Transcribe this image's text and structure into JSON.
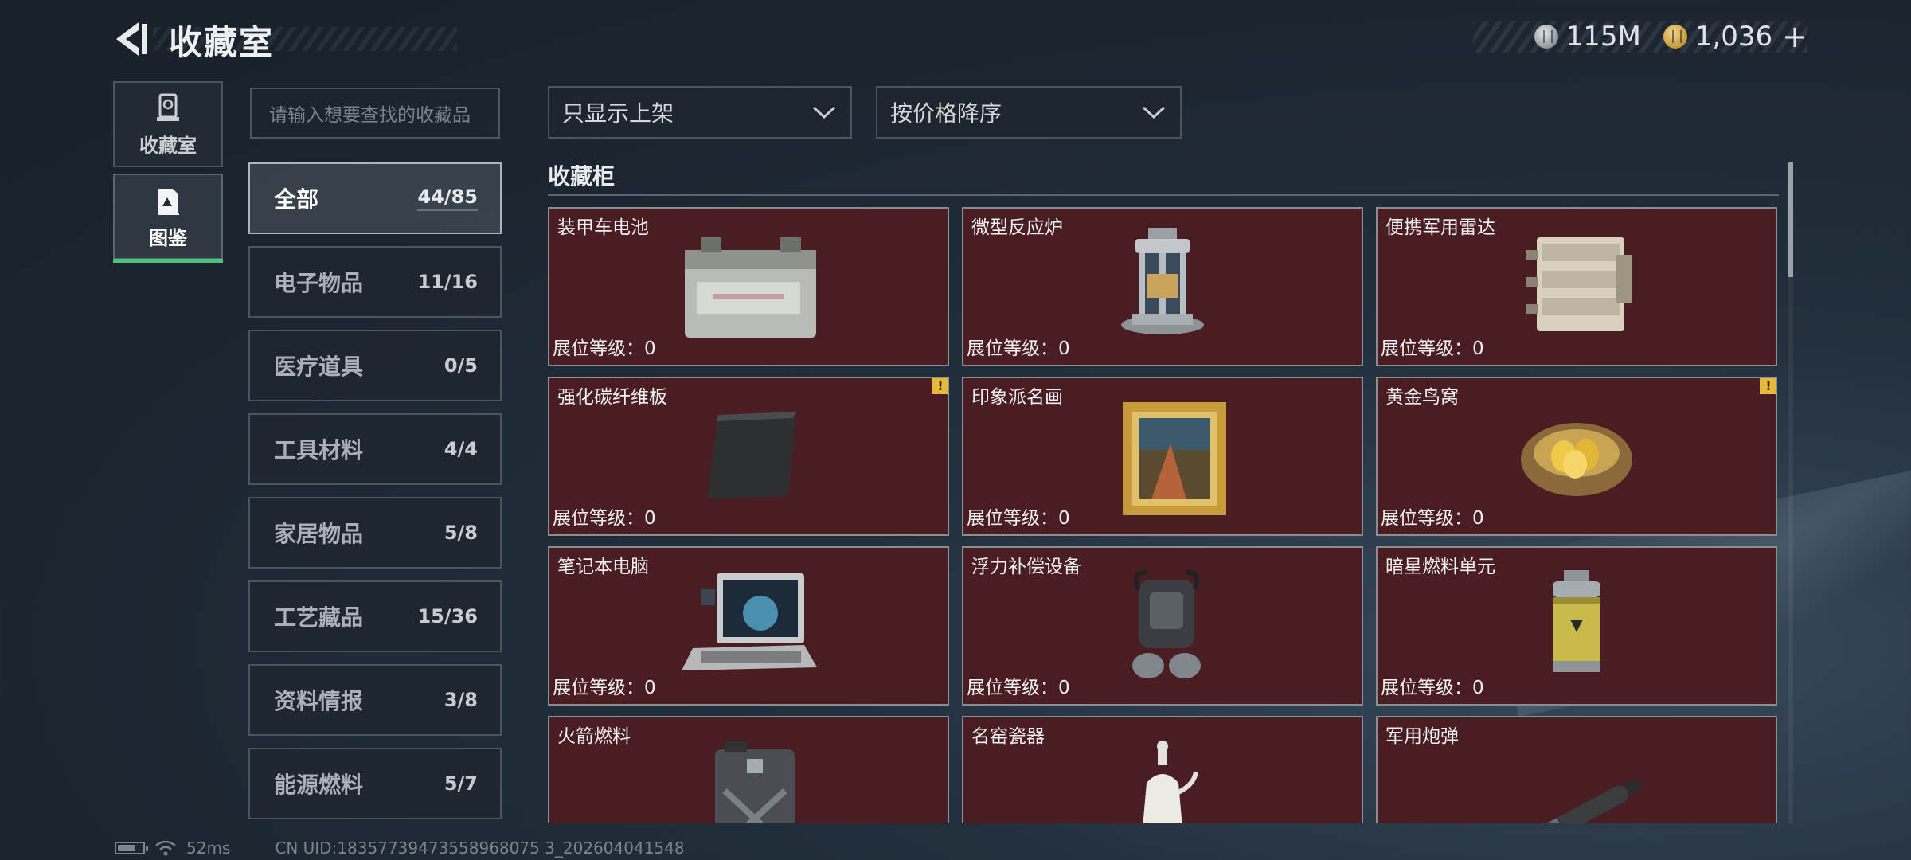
{
  "header": {
    "title": "收藏室",
    "currency": [
      {
        "icon": "silver-coin-icon",
        "value": "115M"
      },
      {
        "icon": "gold-coin-icon",
        "value": "1,036"
      }
    ],
    "add_label": "+"
  },
  "side_nav": [
    {
      "label": "收藏室",
      "icon": "collection-room-icon",
      "active": false
    },
    {
      "label": "图鉴",
      "icon": "codex-icon",
      "active": true
    }
  ],
  "search": {
    "placeholder": "请输入想要查找的收藏品"
  },
  "categories": [
    {
      "name": "全部",
      "count": "44/85",
      "active": true
    },
    {
      "name": "电子物品",
      "count": "11/16"
    },
    {
      "name": "医疗道具",
      "count": "0/5"
    },
    {
      "name": "工具材料",
      "count": "4/4"
    },
    {
      "name": "家居物品",
      "count": "5/8"
    },
    {
      "name": "工艺藏品",
      "count": "15/36"
    },
    {
      "name": "资料情报",
      "count": "3/8"
    },
    {
      "name": "能源燃料",
      "count": "5/7"
    }
  ],
  "filters": {
    "shelf": "只显示上架",
    "sort": "按价格降序"
  },
  "section": {
    "title": "收藏柜"
  },
  "level_label": "展位等级：",
  "items": [
    {
      "name": "装甲车电池",
      "level": "0",
      "icon": "battery-item-icon",
      "warn": false
    },
    {
      "name": "微型反应炉",
      "level": "0",
      "icon": "reactor-item-icon",
      "warn": false
    },
    {
      "name": "便携军用雷达",
      "level": "0",
      "icon": "radar-item-icon",
      "warn": false
    },
    {
      "name": "强化碳纤维板",
      "level": "0",
      "icon": "carbon-plate-item-icon",
      "warn": true
    },
    {
      "name": "印象派名画",
      "level": "0",
      "icon": "painting-item-icon",
      "warn": false
    },
    {
      "name": "黄金鸟窝",
      "level": "0",
      "icon": "golden-nest-item-icon",
      "warn": true
    },
    {
      "name": "笔记本电脑",
      "level": "0",
      "icon": "laptop-item-icon",
      "warn": false
    },
    {
      "name": "浮力补偿设备",
      "level": "0",
      "icon": "buoyancy-device-item-icon",
      "warn": false
    },
    {
      "name": "暗星燃料单元",
      "level": "0",
      "icon": "fuel-cell-item-icon",
      "warn": false
    },
    {
      "name": "火箭燃料",
      "level": "",
      "icon": "jerrycan-item-icon",
      "warn": false
    },
    {
      "name": "名窑瓷器",
      "level": "",
      "icon": "porcelain-item-icon",
      "warn": false
    },
    {
      "name": "军用炮弹",
      "level": "",
      "icon": "shell-item-icon",
      "warn": false
    }
  ],
  "footer": {
    "ping": "52ms",
    "uid": "CN UID:18357739473558968075 3_202604041548"
  }
}
